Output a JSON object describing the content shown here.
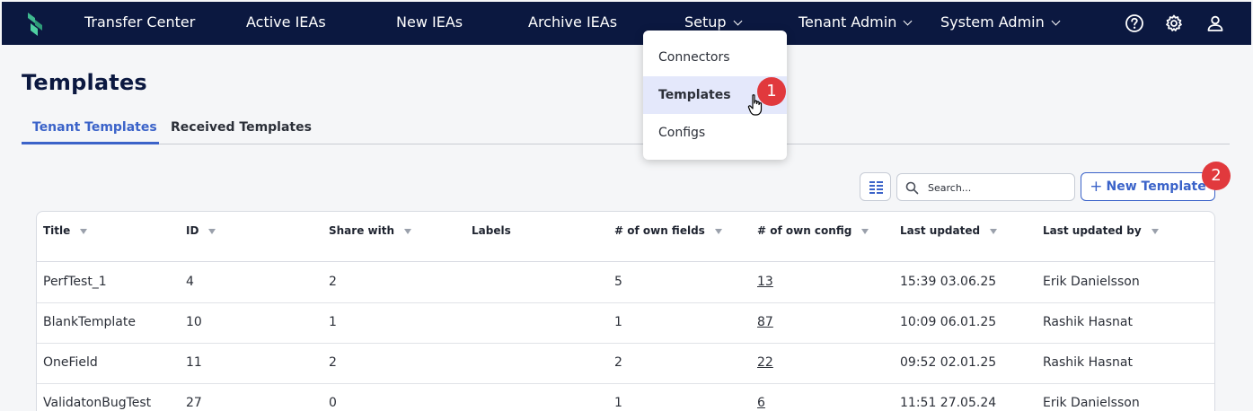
{
  "nav": {
    "items": [
      {
        "label": "Transfer Center"
      },
      {
        "label": "Active IEAs"
      },
      {
        "label": "New IEAs"
      },
      {
        "label": "Archive IEAs"
      },
      {
        "label": "Setup"
      },
      {
        "label": "Tenant Admin"
      },
      {
        "label": "System Admin"
      }
    ],
    "icons": [
      "help-icon",
      "gear-icon",
      "user-icon"
    ]
  },
  "page": {
    "title": "Templates"
  },
  "tabs": [
    {
      "label": "Tenant Templates",
      "active": true
    },
    {
      "label": "Received Templates",
      "active": false
    }
  ],
  "toolbar": {
    "search_placeholder": "Search...",
    "new_plus": "+",
    "new_label": "New Template"
  },
  "table": {
    "columns": [
      "Title",
      "ID",
      "Share with",
      "Labels",
      "# of own fields",
      "# of own config",
      "Last updated",
      "Last updated by"
    ],
    "rows": [
      [
        "PerfTest_1",
        "4",
        "2",
        "",
        "5",
        "13",
        "15:39 03.06.25",
        "Erik Danielsson"
      ],
      [
        "BlankTemplate",
        "10",
        "1",
        "",
        "1",
        "87",
        "10:09 06.01.25",
        "Rashik Hasnat"
      ],
      [
        "OneField",
        "11",
        "2",
        "",
        "2",
        "22",
        "09:52 02.01.25",
        "Rashik Hasnat"
      ],
      [
        "ValidatonBugTest",
        "27",
        "0",
        "",
        "1",
        "6",
        "11:51 27.05.24",
        "Erik Danielsson"
      ]
    ]
  },
  "dropdown": {
    "items": [
      {
        "label": "Connectors"
      },
      {
        "label": "Templates",
        "selected": true
      },
      {
        "label": "Configs"
      }
    ]
  },
  "annotations": {
    "badge1": "1",
    "badge2": "2"
  },
  "colors": {
    "nav_bg": "#0b1840",
    "accent": "#3b63c9",
    "badge": "#e1393d",
    "logo": "#3fb98f"
  }
}
